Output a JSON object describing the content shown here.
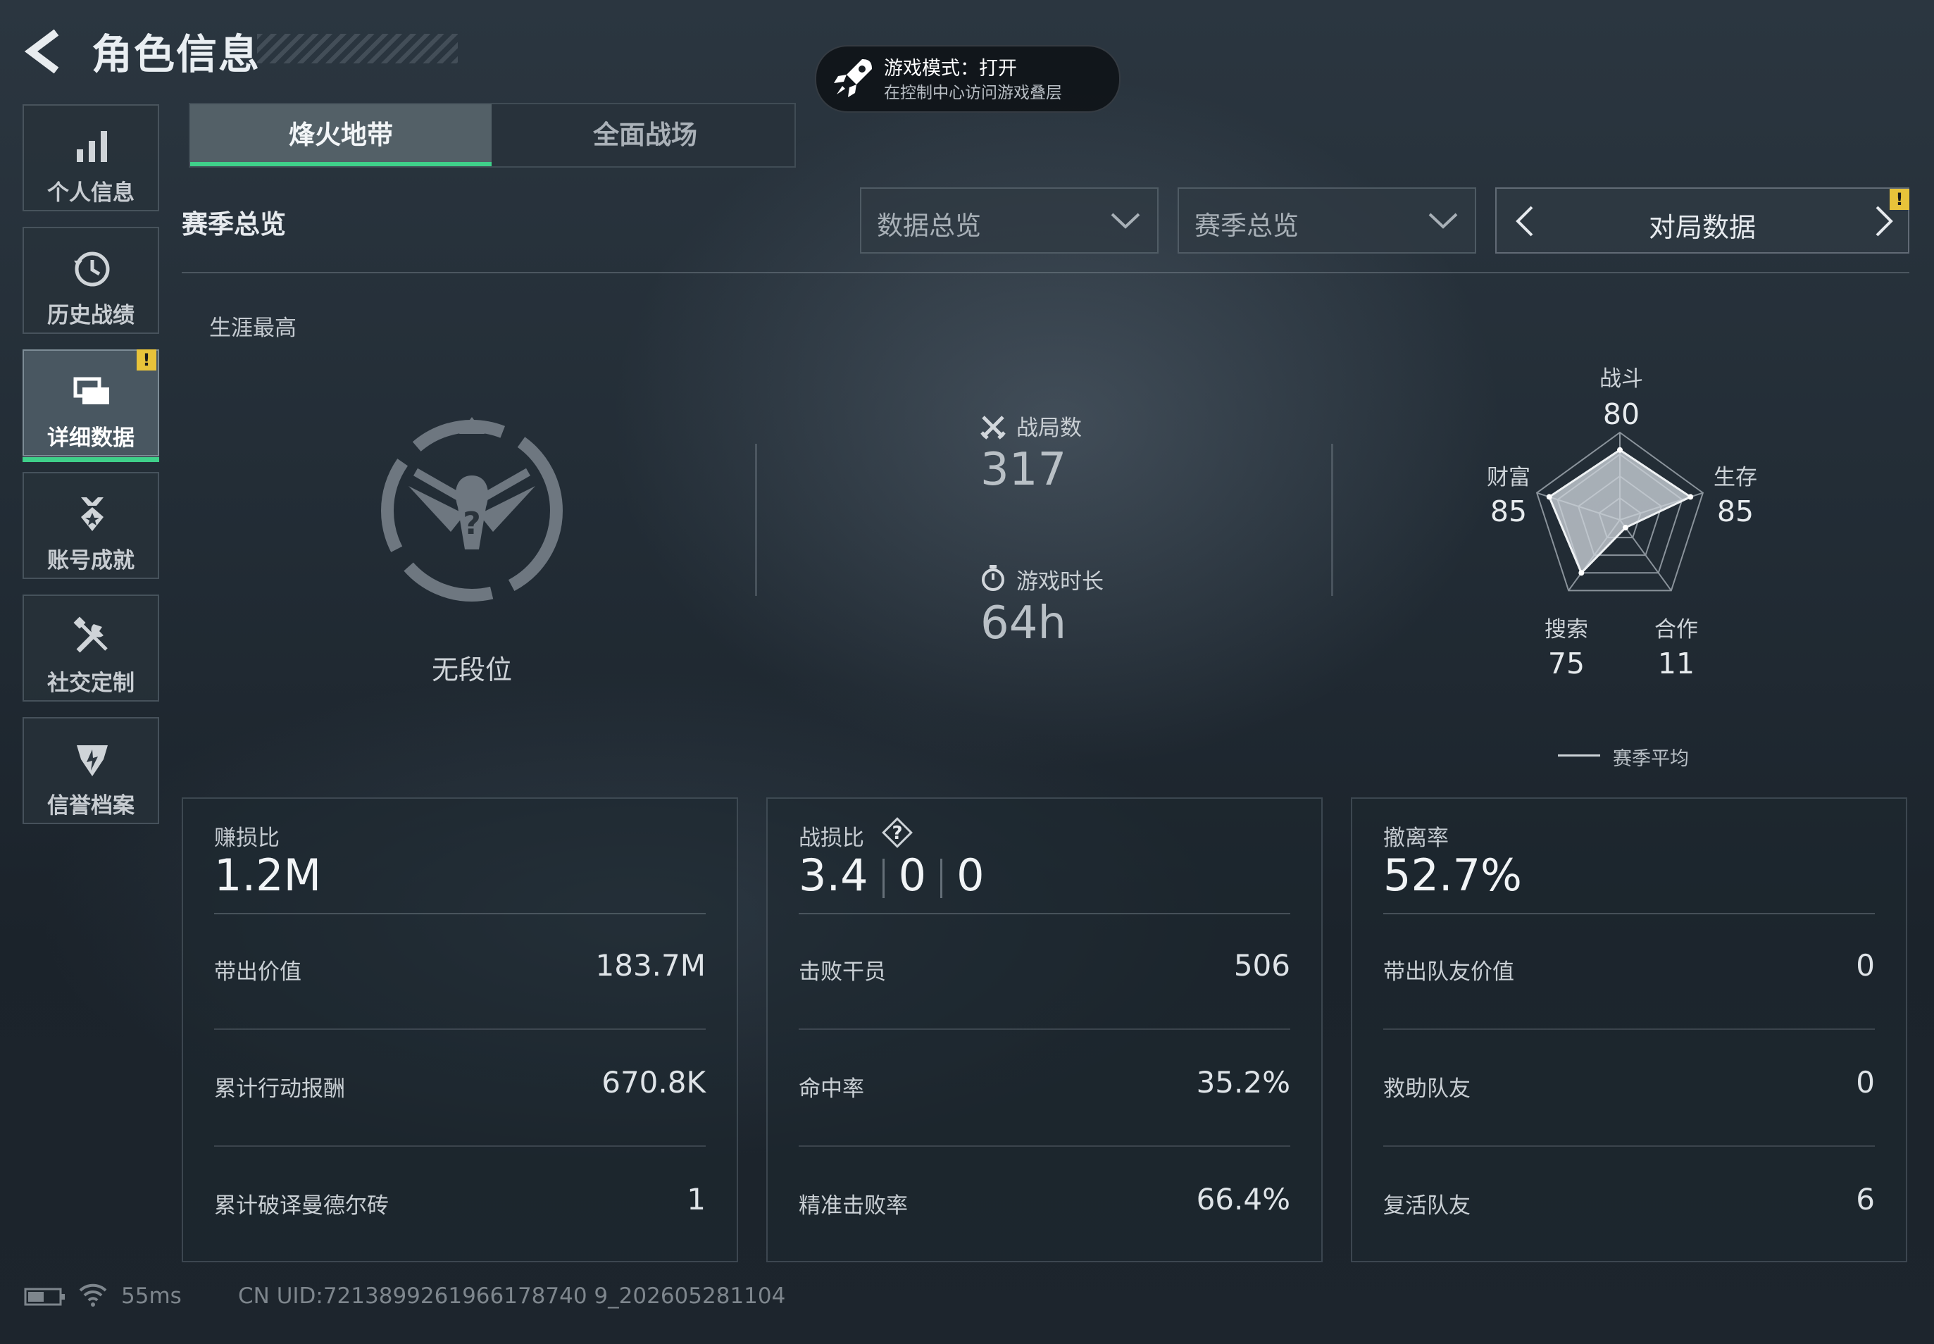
{
  "header": {
    "title": "角色信息"
  },
  "game_mode": {
    "title": "游戏模式：打开",
    "subtitle": "在控制中心访问游戏叠层"
  },
  "sidebar": {
    "items": [
      {
        "label": "个人信息",
        "icon": "bar-chart-icon"
      },
      {
        "label": "历史战绩",
        "icon": "history-icon"
      },
      {
        "label": "详细数据",
        "icon": "cards-icon",
        "active": true,
        "badge": "!"
      },
      {
        "label": "账号成就",
        "icon": "medal-icon"
      },
      {
        "label": "社交定制",
        "icon": "tools-icon"
      },
      {
        "label": "信誉档案",
        "icon": "shield-icon"
      }
    ]
  },
  "tabs": [
    {
      "label": "烽火地带",
      "active": true
    },
    {
      "label": "全面战场",
      "active": false
    }
  ],
  "section": {
    "title": "赛季总览"
  },
  "filters": {
    "data_dropdown": "数据总览",
    "season_dropdown": "赛季总览",
    "pager_label": "对局数据",
    "pager_badge": "!"
  },
  "career": {
    "label": "生涯最高",
    "rank": "无段位",
    "matches_label": "战局数",
    "matches_value": "317",
    "playtime_label": "游戏时长",
    "playtime_value": "64h"
  },
  "radar": {
    "legend": "赛季平均",
    "axes": [
      {
        "label": "战斗",
        "value": "80"
      },
      {
        "label": "生存",
        "value": "85"
      },
      {
        "label": "合作",
        "value": "11"
      },
      {
        "label": "搜索",
        "value": "75"
      },
      {
        "label": "财富",
        "value": "85"
      }
    ]
  },
  "cards": [
    {
      "header_label": "赚损比",
      "header_value": "1.2M",
      "rows": [
        {
          "label": "带出价值",
          "value": "183.7M"
        },
        {
          "label": "累计行动报酬",
          "value": "670.8K"
        },
        {
          "label": "累计破译曼德尔砖",
          "value": "1"
        }
      ]
    },
    {
      "header_label": "战损比",
      "header_values": [
        "3.4",
        "0",
        "0"
      ],
      "help": "?",
      "rows": [
        {
          "label": "击败干员",
          "value": "506"
        },
        {
          "label": "命中率",
          "value": "35.2%"
        },
        {
          "label": "精准击败率",
          "value": "66.4%"
        }
      ]
    },
    {
      "header_label": "撤离率",
      "header_value": "52.7%",
      "rows": [
        {
          "label": "带出队友价值",
          "value": "0"
        },
        {
          "label": "救助队友",
          "value": "0"
        },
        {
          "label": "复活队友",
          "value": "6"
        }
      ]
    }
  ],
  "status_bar": {
    "latency": "55ms",
    "uid": "CN UID:7213899261966178740 9_202605281104"
  },
  "colors": {
    "accent": "#3fd08a",
    "warning": "#e8c33a"
  }
}
